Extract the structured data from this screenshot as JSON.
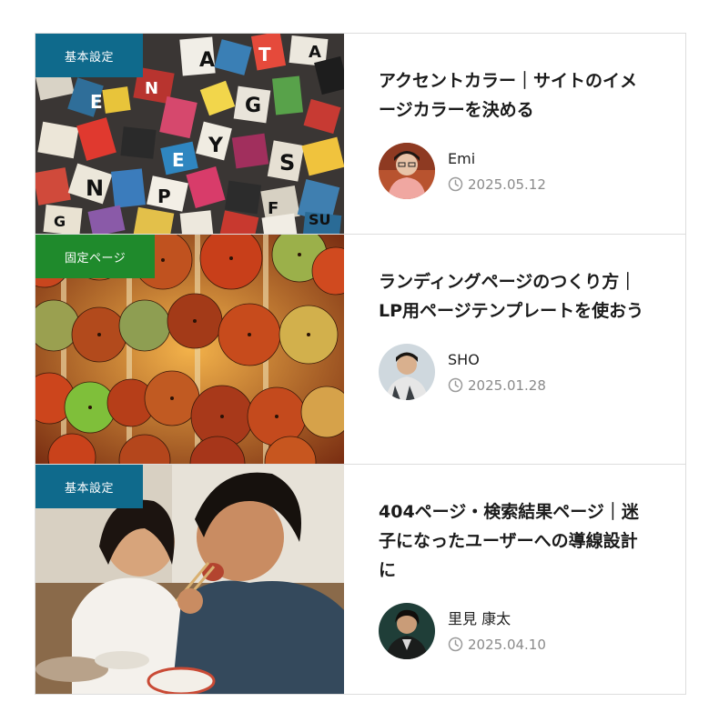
{
  "posts": [
    {
      "category": "基本設定",
      "category_color": "#0f6a8c",
      "title": "アクセントカラー｜サイトのイメージカラーを決める",
      "author": "Emi",
      "date": "2025.05.12",
      "thumbnail": "collage-of-cut-out-letters"
    },
    {
      "category": "固定ページ",
      "category_color": "#1f8a2c",
      "title": "ランディングページのつくり方｜LP用ページテンプレートを使おう",
      "author": "SHO",
      "date": "2025.01.28",
      "thumbnail": "wall-of-paper-umbrellas"
    },
    {
      "category": "基本設定",
      "category_color": "#0f6a8c",
      "title": "404ページ・検索結果ページ｜迷子になったユーザーへの導線設計に",
      "author": "里見 康太",
      "date": "2025.04.10",
      "thumbnail": "couple-eating-noodles"
    }
  ],
  "icons": {
    "date": "clock-icon"
  }
}
